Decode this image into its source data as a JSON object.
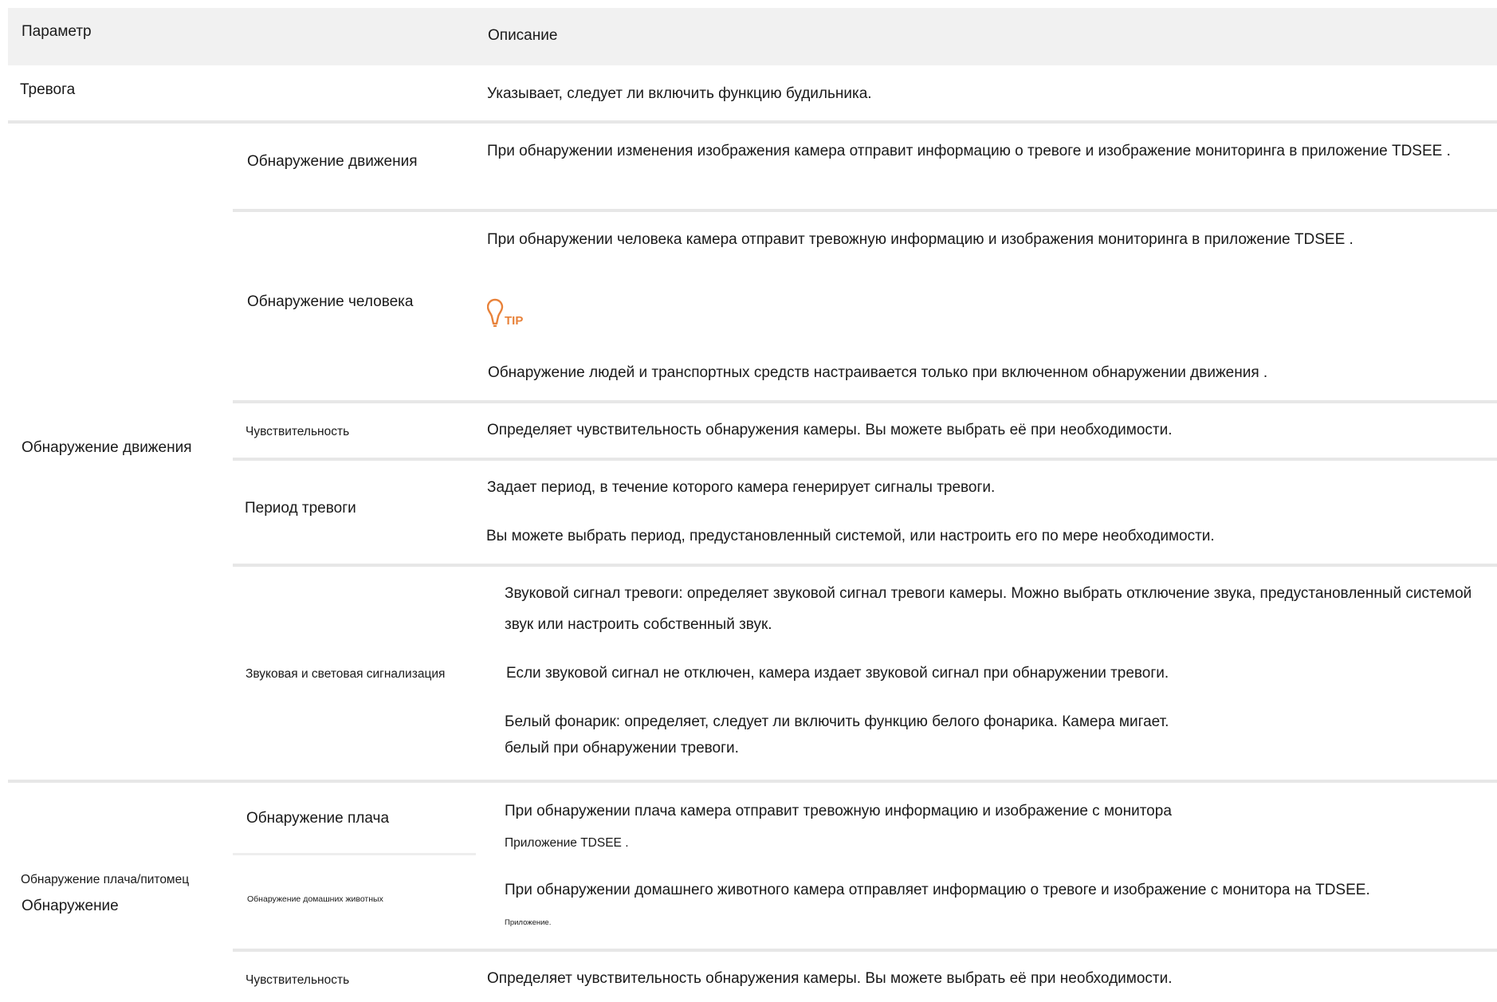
{
  "header": {
    "param": "Параметр",
    "description": "Описание"
  },
  "rows": {
    "alarm": {
      "param": "Тревога",
      "desc": "Указывает, следует ли включить функцию будильника."
    },
    "motion_group": {
      "param": "Обнаружение движения",
      "motion": {
        "label": "Обнаружение движения",
        "desc": "При обнаружении изменения изображения камера отправит информацию о тревоге и изображение мониторинга в приложение TDSEE ."
      },
      "human": {
        "label": "Обнаружение человека",
        "desc": "При обнаружении человека камера отправит тревожную информацию и изображения мониторинга в приложение TDSEE .",
        "tip_label": "TIP",
        "tip_text": "Обнаружение людей и транспортных средств настраивается только при включенном обнаружении движения ."
      },
      "sensitivity": {
        "label": "Чувствительность",
        "desc": "Определяет чувствительность обнаружения камеры. Вы можете выбрать её при необходимости."
      },
      "period": {
        "label": "Период тревоги",
        "desc1": "Задает период, в течение которого камера генерирует сигналы тревоги.",
        "desc2": "Вы можете выбрать период, предустановленный системой, или настроить его по мере необходимости."
      },
      "sound_light": {
        "label": "Звуковая и световая сигнализация",
        "desc1": "Звуковой сигнал тревоги: определяет звуковой сигнал тревоги камеры. Можно выбрать отключение звука, предустановленный системой",
        "desc2": "звук или настроить собственный звук.",
        "desc3": "Если звуковой сигнал не отключен, камера издает звуковой сигнал при обнаружении тревоги.",
        "desc4": "Белый фонарик: определяет, следует ли включить функцию белого фонарика. Камера мигает.",
        "desc5": "белый при обнаружении тревоги."
      }
    },
    "cry_group": {
      "param_line1": "Обнаружение плача/питомец",
      "param_line2": "Обнаружение",
      "cry": {
        "label": "Обнаружение плача",
        "desc1": "При обнаружении плача камера отправит тревожную информацию и изображение с монитора",
        "desc2": "Приложение TDSEE ."
      },
      "pet": {
        "label": "Обнаружение домашних животных",
        "desc1": "При обнаружении домашнего животного камера отправляет информацию о тревоге и изображение с монитора на TDSEE.",
        "desc2": "Приложение."
      },
      "sensitivity": {
        "label": "Чувствительность",
        "desc": "Определяет чувствительность обнаружения камеры. Вы можете выбрать её при необходимости."
      }
    }
  },
  "colors": {
    "header_bg": "#f1f1f1",
    "divider": "#e7e7e7",
    "tip_icon": "#e8823a"
  },
  "icons": {
    "tip": "tip-lightbulb-icon"
  }
}
